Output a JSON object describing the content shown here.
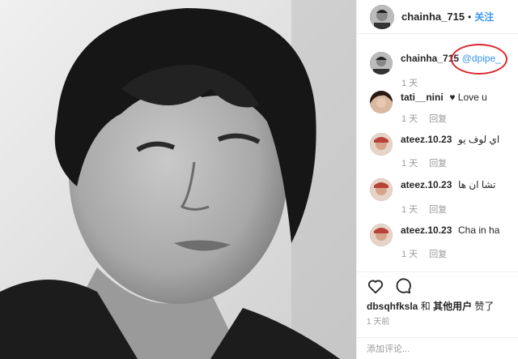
{
  "post": {
    "author": "chainha_715",
    "follow_label": "关注",
    "separator": "•"
  },
  "comments": [
    {
      "user": "chainha_715",
      "text": "",
      "mention": "@dpipe_",
      "time": "1 天",
      "reply": ""
    },
    {
      "user": "tati__nini",
      "text": "♥ Love u",
      "mention": "",
      "time": "1 天",
      "reply": "回复"
    },
    {
      "user": "ateez.10.23",
      "text": "اي لوف يو",
      "mention": "",
      "time": "1 天",
      "reply": "回复"
    },
    {
      "user": "ateez.10.23",
      "text": "تشا ان ها",
      "mention": "",
      "time": "1 天",
      "reply": "回复"
    },
    {
      "user": "ateez.10.23",
      "text": "Cha in ha",
      "mention": "",
      "time": "1 天",
      "reply": "回复"
    }
  ],
  "likes": {
    "user": "dbsqhfksla",
    "joiner": "和",
    "others": "其他用户",
    "suffix": "赞了"
  },
  "posted_time": "1 天前",
  "add_comment_placeholder": "添加评论...",
  "icons": [
    "heart-icon",
    "comment-icon"
  ],
  "colors": {
    "link": "#3897f0",
    "highlight_circle": "#d8262c",
    "muted": "#999999"
  }
}
